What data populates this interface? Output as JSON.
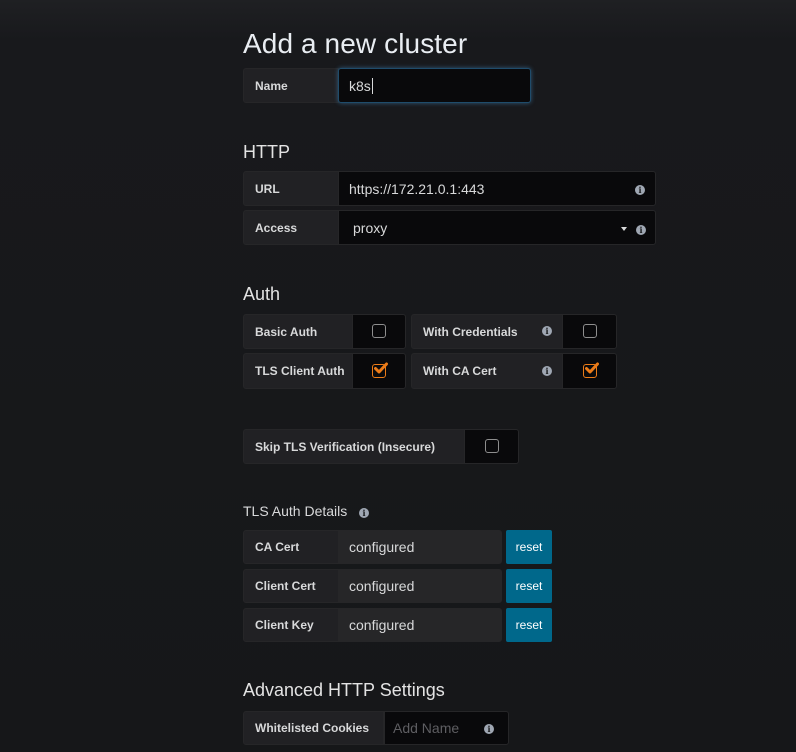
{
  "page": {
    "title": "Add a new cluster"
  },
  "name_field": {
    "label": "Name",
    "value": "k8s"
  },
  "http": {
    "heading": "HTTP",
    "url": {
      "label": "URL",
      "value": "https://172.21.0.1:443",
      "info_icon": "info-circle-icon"
    },
    "access": {
      "label": "Access",
      "value": "proxy",
      "info_icon": "info-circle-icon"
    }
  },
  "auth": {
    "heading": "Auth",
    "basic_auth": {
      "label": "Basic Auth",
      "checked": false
    },
    "with_credentials": {
      "label": "With Credentials",
      "checked": false
    },
    "tls_client_auth": {
      "label": "TLS Client Auth",
      "checked": true
    },
    "with_ca_cert": {
      "label": "With CA Cert",
      "checked": true
    },
    "skip_tls": {
      "label": "Skip TLS Verification (Insecure)",
      "checked": false
    }
  },
  "tls_details": {
    "heading": "TLS Auth Details",
    "rows": [
      {
        "label": "CA Cert",
        "value": "configured",
        "button": "reset"
      },
      {
        "label": "Client Cert",
        "value": "configured",
        "button": "reset"
      },
      {
        "label": "Client Key",
        "value": "configured",
        "button": "reset"
      }
    ]
  },
  "advanced": {
    "heading": "Advanced HTTP Settings",
    "whitelisted_cookies": {
      "label": "Whitelisted Cookies",
      "placeholder": "Add Name"
    }
  },
  "colors": {
    "accent_orange": "#eb7b18",
    "button_blue": "#00688b",
    "background": "#161719"
  }
}
